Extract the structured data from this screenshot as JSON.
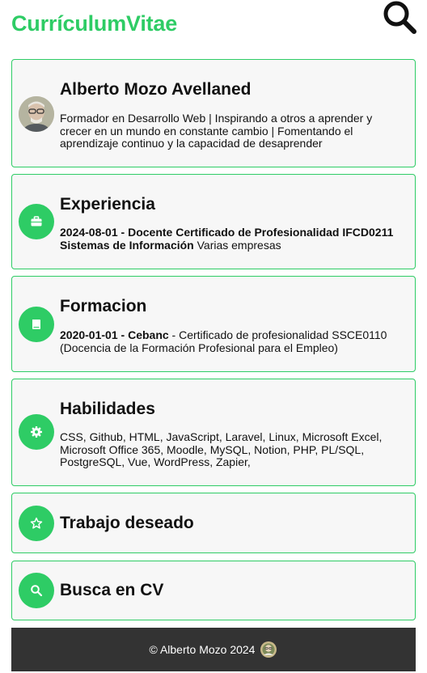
{
  "header": {
    "title": "CurrículumVitae",
    "search_icon": "search-icon"
  },
  "profile": {
    "name": "Alberto Mozo Avellaned",
    "bio": "Formador en Desarrollo Web | Inspirando a otros a aprender y crecer en un mundo en constante cambio | Fomentando el aprendizaje continuo y la capacidad de desaprender"
  },
  "experience": {
    "title": "Experiencia",
    "icon": "briefcase-icon",
    "date": "2024-08-01",
    "role": "Docente Certificado de Profesionalidad IFCD0211 Sistemas de Información",
    "company": "Varias empresas"
  },
  "education": {
    "title": "Formacion",
    "icon": "book-icon",
    "date": "2020-01-01",
    "school": "Cebanc",
    "degree": "Certificado de profesionalidad SSCE0110 (Docencia de la Formación Profesional para el Empleo)"
  },
  "skills": {
    "title": "Habilidades",
    "icon": "gear-icon",
    "list": "CSS, Github, HTML, JavaScript, Laravel, Linux, Microsoft Excel, Microsoft Office 365, Moodle, MySQL, Notion, PHP, PL/SQL, PostgreSQL, Vue, WordPress, Zapier,"
  },
  "desired_job": {
    "title": "Trabajo deseado",
    "icon": "star-icon"
  },
  "search_cv": {
    "title": "Busca en CV",
    "icon": "search-icon"
  },
  "footer": {
    "text": "© Alberto Mozo 2024"
  },
  "colors": {
    "accent": "#2ecc65",
    "card_bg": "#f7f7f7",
    "footer_bg": "#333333"
  }
}
